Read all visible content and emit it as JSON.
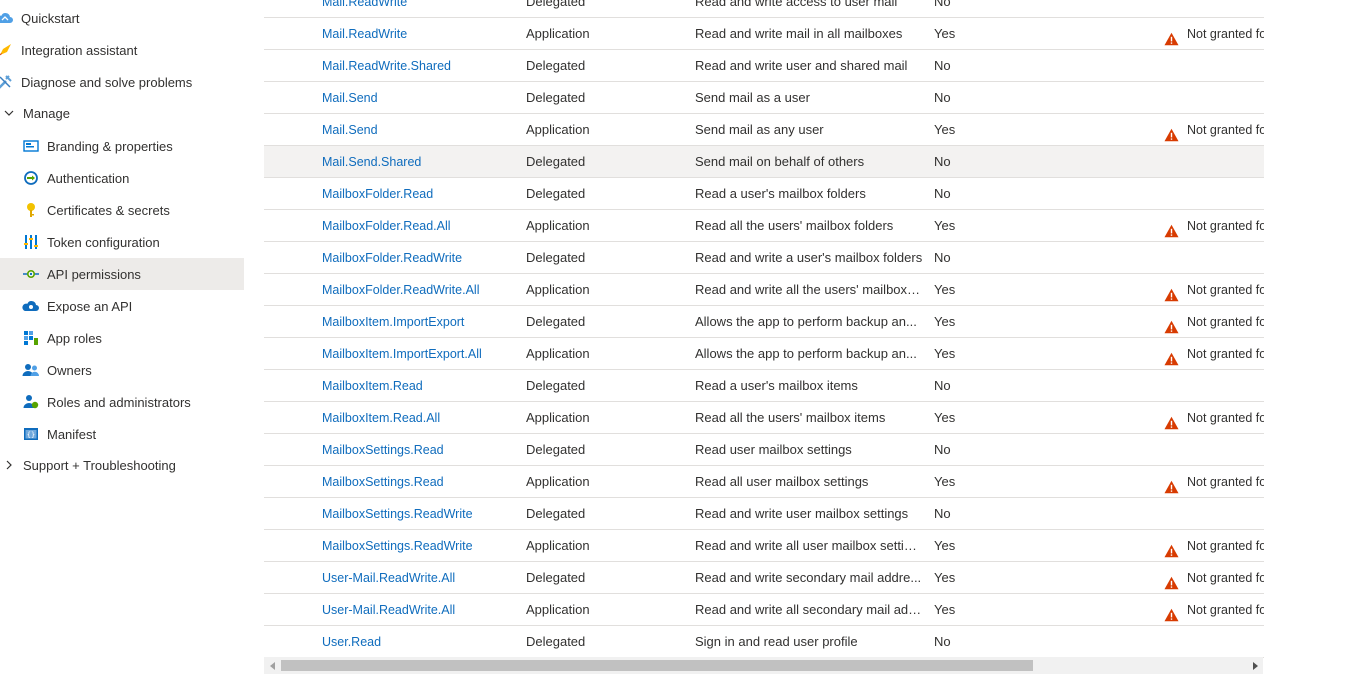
{
  "sidebar": {
    "quickstart": "Quickstart",
    "integration": "Integration assistant",
    "diagnose": "Diagnose and solve problems",
    "manage": "Manage",
    "branding": "Branding & properties",
    "authentication": "Authentication",
    "certificates": "Certificates & secrets",
    "token": "Token configuration",
    "api_permissions": "API permissions",
    "expose": "Expose an API",
    "app_roles": "App roles",
    "owners": "Owners",
    "roles_admins": "Roles and administrators",
    "manifest": "Manifest",
    "support": "Support + Troubleshooting"
  },
  "table": {
    "rows": [
      {
        "name": "Mail.ReadWrite",
        "type": "Delegated",
        "desc": "Read and write access to user mail",
        "admin": "No",
        "status": ""
      },
      {
        "name": "Mail.ReadWrite",
        "type": "Application",
        "desc": "Read and write mail in all mailboxes",
        "admin": "Yes",
        "status": "Not granted fo"
      },
      {
        "name": "Mail.ReadWrite.Shared",
        "type": "Delegated",
        "desc": "Read and write user and shared mail",
        "admin": "No",
        "status": ""
      },
      {
        "name": "Mail.Send",
        "type": "Delegated",
        "desc": "Send mail as a user",
        "admin": "No",
        "status": ""
      },
      {
        "name": "Mail.Send",
        "type": "Application",
        "desc": "Send mail as any user",
        "admin": "Yes",
        "status": "Not granted fo"
      },
      {
        "name": "Mail.Send.Shared",
        "type": "Delegated",
        "desc": "Send mail on behalf of others",
        "admin": "No",
        "status": ""
      },
      {
        "name": "MailboxFolder.Read",
        "type": "Delegated",
        "desc": "Read a user's mailbox folders",
        "admin": "No",
        "status": ""
      },
      {
        "name": "MailboxFolder.Read.All",
        "type": "Application",
        "desc": "Read all the users' mailbox folders",
        "admin": "Yes",
        "status": "Not granted fo"
      },
      {
        "name": "MailboxFolder.ReadWrite",
        "type": "Delegated",
        "desc": "Read and write a user's mailbox folders",
        "admin": "No",
        "status": ""
      },
      {
        "name": "MailboxFolder.ReadWrite.All",
        "type": "Application",
        "desc": "Read and write all the users' mailbox f...",
        "admin": "Yes",
        "status": "Not granted fo"
      },
      {
        "name": "MailboxItem.ImportExport",
        "type": "Delegated",
        "desc": "Allows the app to perform backup an...",
        "admin": "Yes",
        "status": "Not granted fo"
      },
      {
        "name": "MailboxItem.ImportExport.All",
        "type": "Application",
        "desc": "Allows the app to perform backup an...",
        "admin": "Yes",
        "status": "Not granted fo"
      },
      {
        "name": "MailboxItem.Read",
        "type": "Delegated",
        "desc": "Read a user's mailbox items",
        "admin": "No",
        "status": ""
      },
      {
        "name": "MailboxItem.Read.All",
        "type": "Application",
        "desc": "Read all the users' mailbox items",
        "admin": "Yes",
        "status": "Not granted fo"
      },
      {
        "name": "MailboxSettings.Read",
        "type": "Delegated",
        "desc": "Read user mailbox settings",
        "admin": "No",
        "status": ""
      },
      {
        "name": "MailboxSettings.Read",
        "type": "Application",
        "desc": "Read all user mailbox settings",
        "admin": "Yes",
        "status": "Not granted fo"
      },
      {
        "name": "MailboxSettings.ReadWrite",
        "type": "Delegated",
        "desc": "Read and write user mailbox settings",
        "admin": "No",
        "status": ""
      },
      {
        "name": "MailboxSettings.ReadWrite",
        "type": "Application",
        "desc": "Read and write all user mailbox settings",
        "admin": "Yes",
        "status": "Not granted fo"
      },
      {
        "name": "User-Mail.ReadWrite.All",
        "type": "Delegated",
        "desc": "Read and write secondary mail addre...",
        "admin": "Yes",
        "status": "Not granted fo"
      },
      {
        "name": "User-Mail.ReadWrite.All",
        "type": "Application",
        "desc": "Read and write all secondary mail add...",
        "admin": "Yes",
        "status": "Not granted fo"
      },
      {
        "name": "User.Read",
        "type": "Delegated",
        "desc": "Sign in and read user profile",
        "admin": "No",
        "status": ""
      }
    ]
  },
  "colors": {
    "link": "#0f6cbd",
    "warning": "#d83b01",
    "selected_bg": "#edebe9",
    "hover_bg": "#f3f2f1"
  },
  "icons": {
    "quickstart": "cloud-icon",
    "integration": "rocket-icon",
    "diagnose": "wrench-icon",
    "warning": "warning-triangle-icon"
  }
}
